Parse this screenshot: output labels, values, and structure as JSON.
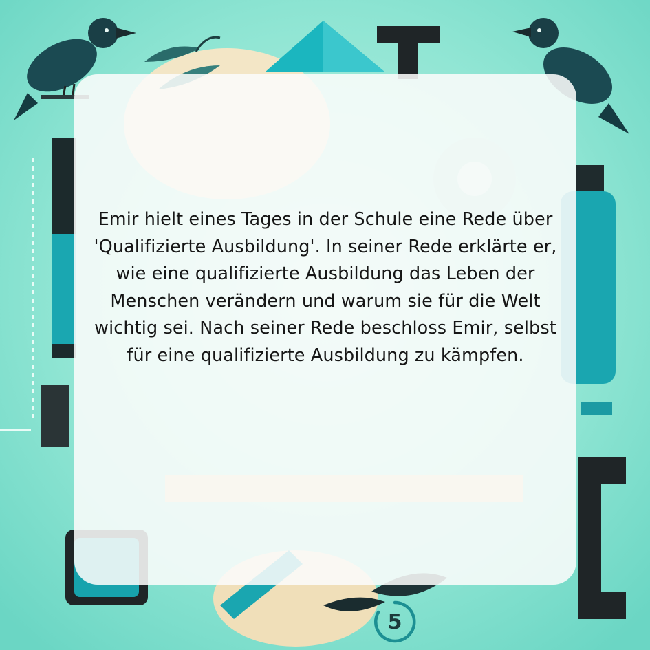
{
  "story": {
    "text": "Emir hielt eines Tages in der Schule eine Rede über 'Qualifizierte Ausbildung'. In seiner Rede erklärte er, wie eine qualifizierte Ausbildung das Leben der Menschen verändern und warum sie für die Welt wichtig sei. Nach seiner Rede beschloss Emir, selbst für eine qualifizierte Ausbildung zu kämpfen."
  },
  "page": {
    "number": "5"
  },
  "colors": {
    "background": "#7fe0cf",
    "teal": "#1aa9b3",
    "dark": "#1d2a2c",
    "card": "#fafcfb",
    "badge_ring": "#1c8f93"
  },
  "decorations": [
    "crow-left-illustration",
    "crow-right-illustration",
    "teal-triangle",
    "gear",
    "bottle",
    "letter-t",
    "ruler",
    "pencil"
  ]
}
